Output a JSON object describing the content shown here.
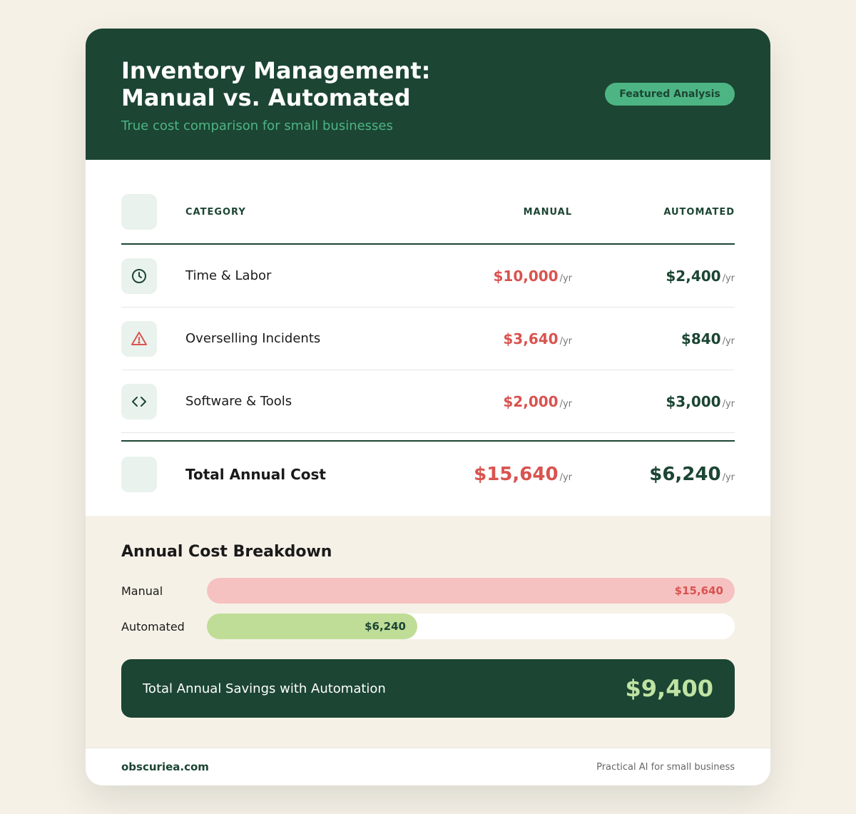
{
  "header": {
    "title_line1": "Inventory Management:",
    "title_line2": "Manual vs. Automated",
    "subtitle": "True cost comparison for small businesses",
    "badge": "Featured Analysis"
  },
  "table": {
    "columns": {
      "category": "CATEGORY",
      "manual": "MANUAL",
      "automated": "AUTOMATED"
    },
    "unit": "/yr",
    "rows": [
      {
        "icon": "clock-icon",
        "category": "Time & Labor",
        "manual": "$10,000",
        "automated": "$2,400"
      },
      {
        "icon": "warning-icon",
        "category": "Overselling Incidents",
        "manual": "$3,640",
        "automated": "$840"
      },
      {
        "icon": "code-icon",
        "category": "Software & Tools",
        "manual": "$2,000",
        "automated": "$3,000"
      }
    ],
    "total": {
      "category": "Total Annual Cost",
      "manual": "$15,640",
      "automated": "$6,240"
    }
  },
  "breakdown": {
    "title": "Annual Cost Breakdown",
    "bars": [
      {
        "label": "Manual",
        "value_text": "$15,640",
        "fraction": 1.0,
        "color": "#f6c1c1",
        "text_color": "#d9534f"
      },
      {
        "label": "Automated",
        "value_text": "$6,240",
        "fraction": 0.399,
        "color": "#bfdd97",
        "text_color": "#1c4533"
      }
    ]
  },
  "savings": {
    "label": "Total Annual Savings with Automation",
    "value": "$9,400"
  },
  "footer": {
    "brand": "obscuriea.com",
    "tagline": "Practical AI for small business"
  },
  "colors": {
    "primary": "#1c4533",
    "accent": "#4db584",
    "manual": "#d9534f",
    "background": "#f6f1e7"
  }
}
